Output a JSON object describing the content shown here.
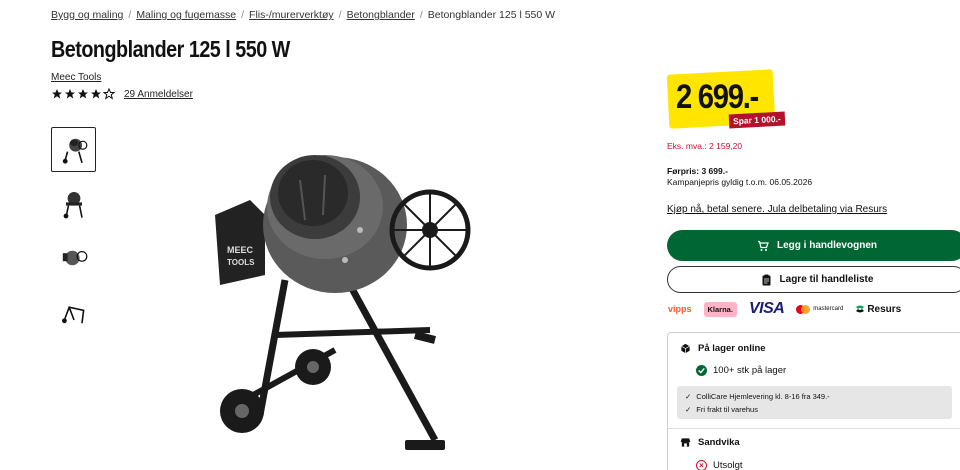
{
  "breadcrumb": {
    "items": [
      "Bygg og maling",
      "Maling og fugemasse",
      "Flis-/murerverktøy",
      "Betongblander"
    ],
    "current": "Betongblander 125 l 550 W"
  },
  "product": {
    "title": "Betongblander 125 l 550 W",
    "brand": "Meec Tools",
    "rating": 4,
    "rating_max": 5,
    "reviews": "29 Anmeldelser"
  },
  "gallery": {
    "thumb_count": 4,
    "active_index": 0
  },
  "pricing": {
    "price": "2 699.-",
    "save": "Spar 1 000.-",
    "ex_vat": "Eks. mva.: 2 159,20",
    "previous": "Førpris: 3 699.-",
    "campaign": "Kampanjepris gyldig t.o.m. 06.05.2026",
    "finance": "Kjøp nå, betal senere. Jula delbetaling via Resurs"
  },
  "actions": {
    "add_to_cart": "Legg i handlevognen",
    "save_to_list": "Lagre til handleliste"
  },
  "payments": {
    "vipps": "vipps",
    "klarna": "Klarna.",
    "visa": "VISA",
    "mastercard": "mastercard",
    "resurs": "Resurs"
  },
  "stock": {
    "online_label": "På lager online",
    "online_qty": "100+ stk på lager",
    "delivery": [
      "ColliCare Hjemlevering kl. 8-16 fra 349.-",
      "Fri frakt til varehus"
    ],
    "store_name": "Sandvika",
    "store_status": "Utsolgt"
  },
  "colors": {
    "accent_green": "#006633",
    "price_yellow": "#ffe500",
    "sale_red": "#b3122a"
  }
}
